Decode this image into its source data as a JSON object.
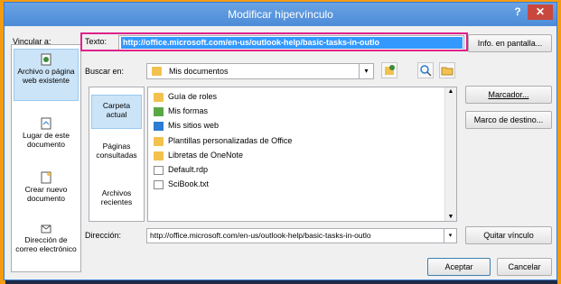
{
  "dialog": {
    "title": "Modificar hipervínculo",
    "help_glyph": "?",
    "close_glyph": "✕"
  },
  "vincular_label": "Vincular a:",
  "sidebar": {
    "items": [
      {
        "label": "Archivo o página web existente",
        "icon": "web-page-icon",
        "selected": true
      },
      {
        "label": "Lugar de este documento",
        "icon": "document-place-icon",
        "selected": false
      },
      {
        "label": "Crear nuevo documento",
        "icon": "new-document-icon",
        "selected": false
      },
      {
        "label": "Dirección de correo electrónico",
        "icon": "email-icon",
        "selected": false
      }
    ]
  },
  "text_field": {
    "label": "Texto:",
    "value": "http://office.microsoft.com/en-us/outlook-help/basic-tasks-in-outlo"
  },
  "buttons": {
    "info": "Info. en pantalla...",
    "marcador": "Marcador...",
    "marco": "Marco de destino...",
    "quitar": "Quitar vínculo",
    "aceptar": "Aceptar",
    "cancelar": "Cancelar"
  },
  "search": {
    "label": "Buscar en:",
    "value": "Mis documentos"
  },
  "places": [
    {
      "label": "Carpeta actual",
      "selected": true
    },
    {
      "label": "Páginas consultadas",
      "selected": false
    },
    {
      "label": "Archivos recientes",
      "selected": false
    }
  ],
  "files": [
    {
      "name": "Guía de roles",
      "icon": "folder-icon"
    },
    {
      "name": "Mis formas",
      "icon": "forms-icon"
    },
    {
      "name": "Mis sitios web",
      "icon": "websites-icon"
    },
    {
      "name": "Plantillas personalizadas de Office",
      "icon": "folder-icon"
    },
    {
      "name": "Libretas de OneNote",
      "icon": "folder-icon"
    },
    {
      "name": "Default.rdp",
      "icon": "rdp-file-icon"
    },
    {
      "name": "SciBook.txt",
      "icon": "text-file-icon"
    }
  ],
  "address": {
    "label": "Dirección:",
    "value": "http://office.microsoft.com/en-us/outlook-help/basic-tasks-in-outlo"
  },
  "colors": {
    "titlebar": "#4c8bd8",
    "highlight": "#e0218a",
    "selection": "#3399ff",
    "close": "#c9483e"
  }
}
